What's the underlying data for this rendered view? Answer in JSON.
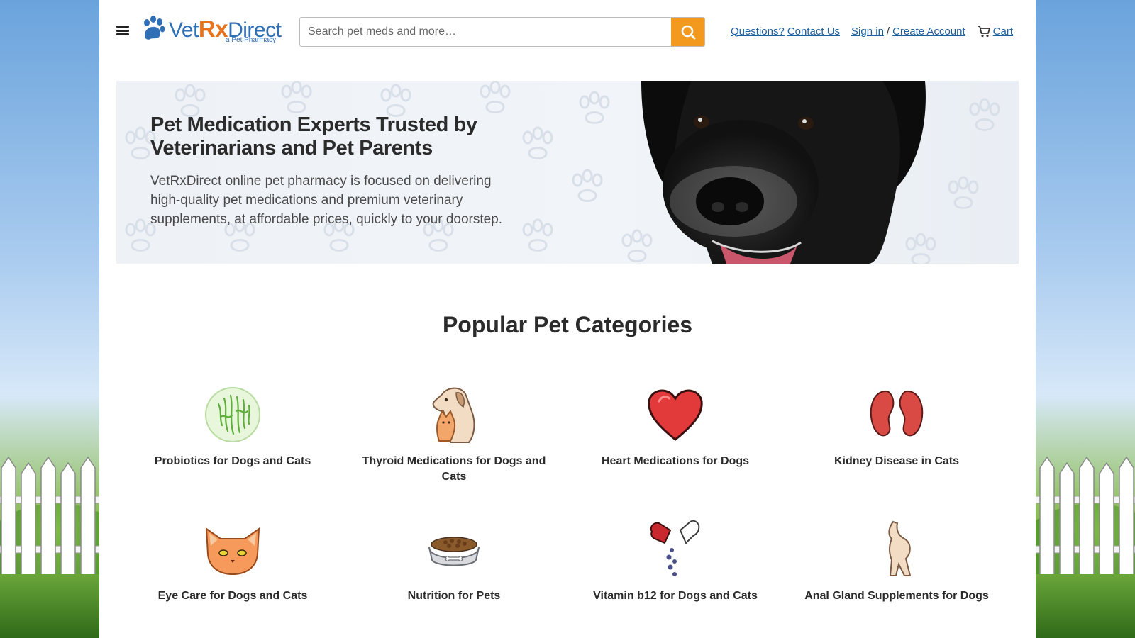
{
  "header": {
    "logo_name_part1": "Vet",
    "logo_name_rx": "Rx",
    "logo_name_part2": "Direct",
    "logo_tagline": "a Pet Pharmacy",
    "search_placeholder": "Search pet meds and more…",
    "questions_label": "Questions?",
    "contact_label": "Contact Us",
    "signin_label": "Sign in",
    "separator": "/",
    "create_account_label": "Create Account",
    "cart_label": "Cart"
  },
  "hero": {
    "title": "Pet Medication Experts Trusted by Veterinarians and Pet Parents",
    "description": "VetRxDirect online pet pharmacy is focused on delivering high-quality pet medications and premium veterinary supplements, at affordable prices, quickly to your doorstep."
  },
  "categories": {
    "heading": "Popular Pet Categories",
    "items": [
      {
        "label": "Probiotics for Dogs and Cats",
        "icon": "probiotics-icon"
      },
      {
        "label": "Thyroid Medications for Dogs and Cats",
        "icon": "dog-and-cat-icon"
      },
      {
        "label": "Heart Medications for Dogs",
        "icon": "heart-icon"
      },
      {
        "label": "Kidney Disease in Cats",
        "icon": "kidneys-icon"
      },
      {
        "label": "Eye Care for Dogs and Cats",
        "icon": "cat-face-icon"
      },
      {
        "label": "Nutrition for Pets",
        "icon": "food-bowl-icon"
      },
      {
        "label": "Vitamin b12 for Dogs and Cats",
        "icon": "capsule-icon"
      },
      {
        "label": "Anal Gland Supplements for Dogs",
        "icon": "dog-tail-icon"
      }
    ]
  },
  "colors": {
    "brand_blue": "#2f6fb5",
    "brand_orange": "#e8731f",
    "search_button": "#f39a1e",
    "link": "#1f5f9e"
  }
}
